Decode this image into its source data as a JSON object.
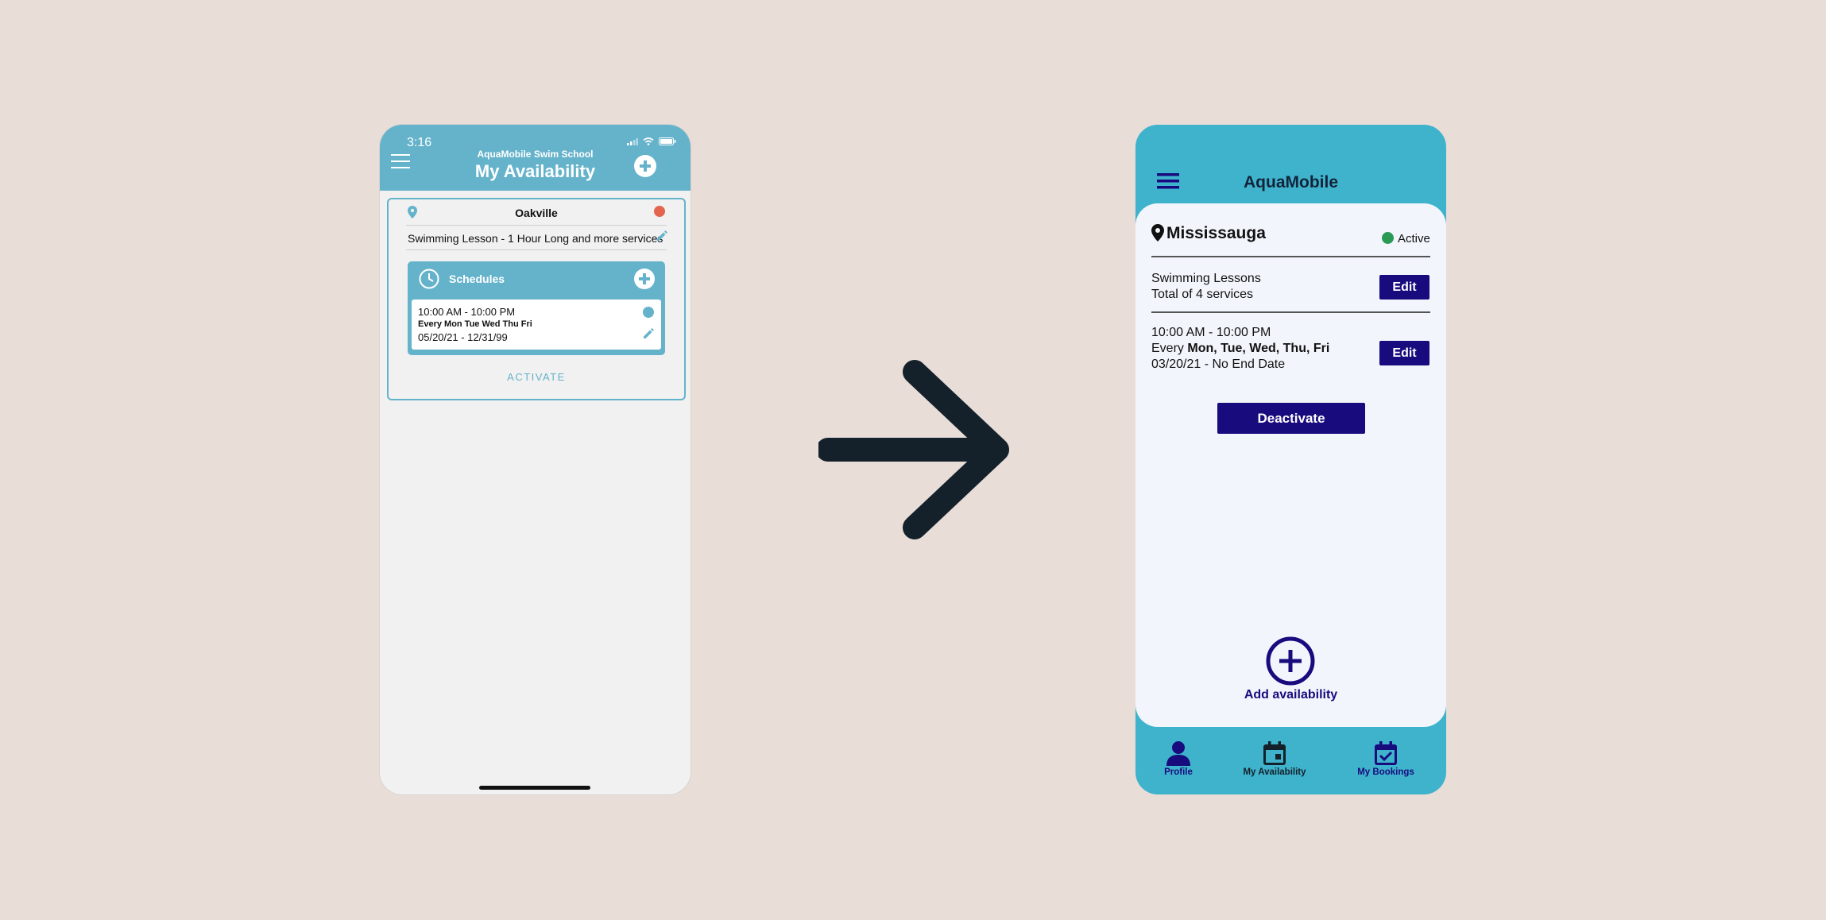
{
  "old_screen": {
    "status_time": "3:16",
    "app_subtitle": "AquaMobile Swim School",
    "page_title": "My Availability",
    "location": "Oakville",
    "service_summary": "Swimming Lesson - 1 Hour Long and more services",
    "schedules_label": "Schedules",
    "schedule": {
      "time_range": "10:00 AM - 10:00 PM",
      "days": "Every Mon Tue Wed Thu Fri",
      "date_range": "05/20/21 - 12/31/99"
    },
    "activate_label": "ACTIVATE",
    "colors": {
      "header": "#65b3cb",
      "inactive_dot": "#e3654f"
    }
  },
  "new_screen": {
    "app_title": "AquaMobile",
    "location": "Mississauga",
    "status": "Active",
    "service_line1": "Swimming Lessons",
    "service_line2": "Total of 4 services",
    "edit_label": "Edit",
    "schedule": {
      "time_range": "10:00 AM - 10:00 PM",
      "days_prefix": "Every",
      "days": "Mon, Tue, Wed, Thu, Fri",
      "date_range": "03/20/21 - No End Date"
    },
    "deactivate_label": "Deactivate",
    "add_label": "Add availability",
    "tabs": [
      {
        "label": "Profile",
        "icon": "person-icon"
      },
      {
        "label": "My Availability",
        "icon": "calendar-icon"
      },
      {
        "label": "My Bookings",
        "icon": "calendar-check-icon"
      }
    ],
    "colors": {
      "accent": "#3fb3cc",
      "primary": "#170b7e",
      "active_dot": "#2a9a55"
    }
  }
}
